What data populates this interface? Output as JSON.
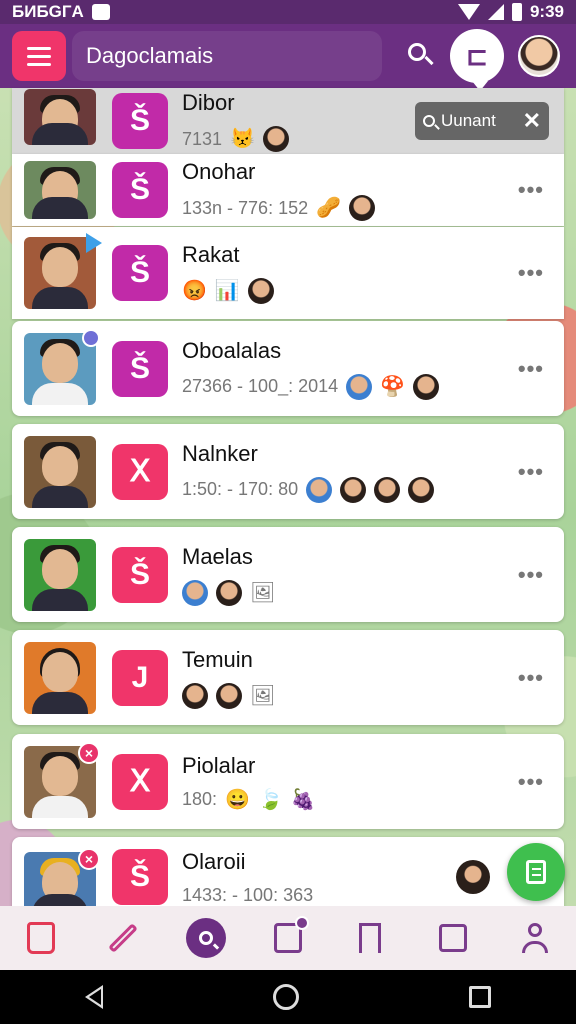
{
  "status_bar": {
    "left_text": "БИБGГA",
    "time": "9:39"
  },
  "app_bar": {
    "title": "Dagoclamais"
  },
  "float_search": {
    "label": "Uunant"
  },
  "conversations": [
    {
      "name": "Dibor",
      "meta": "7131",
      "emojis": [
        "😾"
      ],
      "icon_glyph": "Š",
      "icon_color": "magenta",
      "thumb_bg": "#6a3a3a"
    },
    {
      "name": "Onohar",
      "meta": "133n - 776: 152",
      "emojis": [
        "🥜"
      ],
      "icon_glyph": "Š",
      "icon_color": "magenta",
      "thumb_bg": "#6d8a5f"
    },
    {
      "name": "Rakat",
      "meta": "",
      "emojis": [
        "😡",
        "📊"
      ],
      "icon_glyph": "Š",
      "icon_color": "magenta",
      "thumb_bg": "#a25a3a"
    },
    {
      "name": "Oboalalas",
      "meta": "27366 - 100_: 2014",
      "emojis": [
        "🍄"
      ],
      "icon_glyph": "Š",
      "icon_color": "magenta",
      "thumb_bg": "#5c9bbf"
    },
    {
      "name": "Nalnker",
      "meta": "1:50: - 170: 80",
      "emojis": [],
      "icon_glyph": "Ⅹ",
      "icon_color": "pink",
      "thumb_bg": "#7a5a3a"
    },
    {
      "name": "Maelas",
      "meta": "",
      "emojis": [
        "🖼"
      ],
      "icon_glyph": "Š",
      "icon_color": "pink",
      "thumb_bg": "#3a9a3a"
    },
    {
      "name": "Temuin",
      "meta": "",
      "emojis": [
        "🖼"
      ],
      "icon_glyph": "J",
      "icon_color": "pink",
      "thumb_bg": "#e07a2a"
    },
    {
      "name": "Piolalar",
      "meta": "180:",
      "emojis": [
        "😀",
        "🍃",
        "🍇"
      ],
      "icon_glyph": "Ⅹ",
      "icon_color": "pink",
      "thumb_bg": "#8a6a4a"
    },
    {
      "name": "Olaroii",
      "meta": "1433: - 100: 363",
      "emojis": [],
      "icon_glyph": "Š",
      "icon_color": "pink",
      "thumb_bg": "#4a7ab0"
    }
  ],
  "colors": {
    "primary": "#6b2f82",
    "accent": "#f0356a",
    "magenta": "#c12aa8",
    "fab": "#3fbf4e"
  }
}
